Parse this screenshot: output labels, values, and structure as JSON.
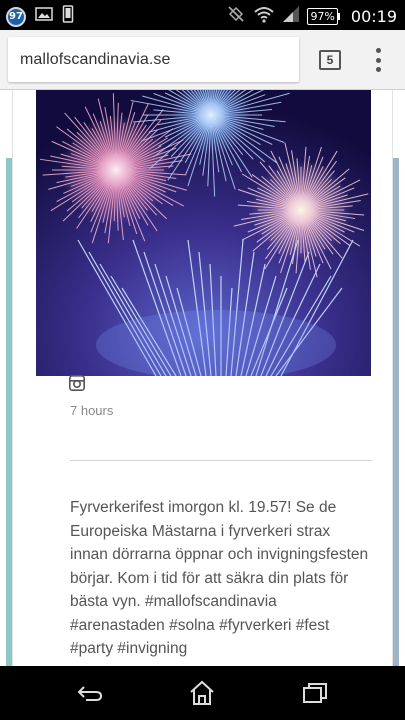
{
  "status_bar": {
    "notification_badge": "97",
    "battery": "97%",
    "time": "00:19",
    "icons": [
      "image-icon",
      "phone-icon",
      "no-sim-icon",
      "wifi-icon",
      "signal-icon"
    ]
  },
  "browser": {
    "url": "mallofscandinavia.se",
    "tab_count": "5"
  },
  "post": {
    "source_icon": "instagram-icon",
    "time_ago": "7 hours",
    "text": "Fyrverkerifest imorgon kl. 19.57! Se de Europeiska Mästarna i fyrverkeri strax innan dörrarna öppnar och invigningsfesten börjar. Kom i tid för att säkra din plats för bästa vyn. #mallofscandinavia #arenastaden #solna #fyrverkeri #fest #party #invigning"
  },
  "nav": {
    "buttons": [
      "back-icon",
      "home-icon",
      "recents-icon"
    ]
  },
  "colors": {
    "accent_teal": "#8fc6c6",
    "sky": "#100c3a"
  }
}
